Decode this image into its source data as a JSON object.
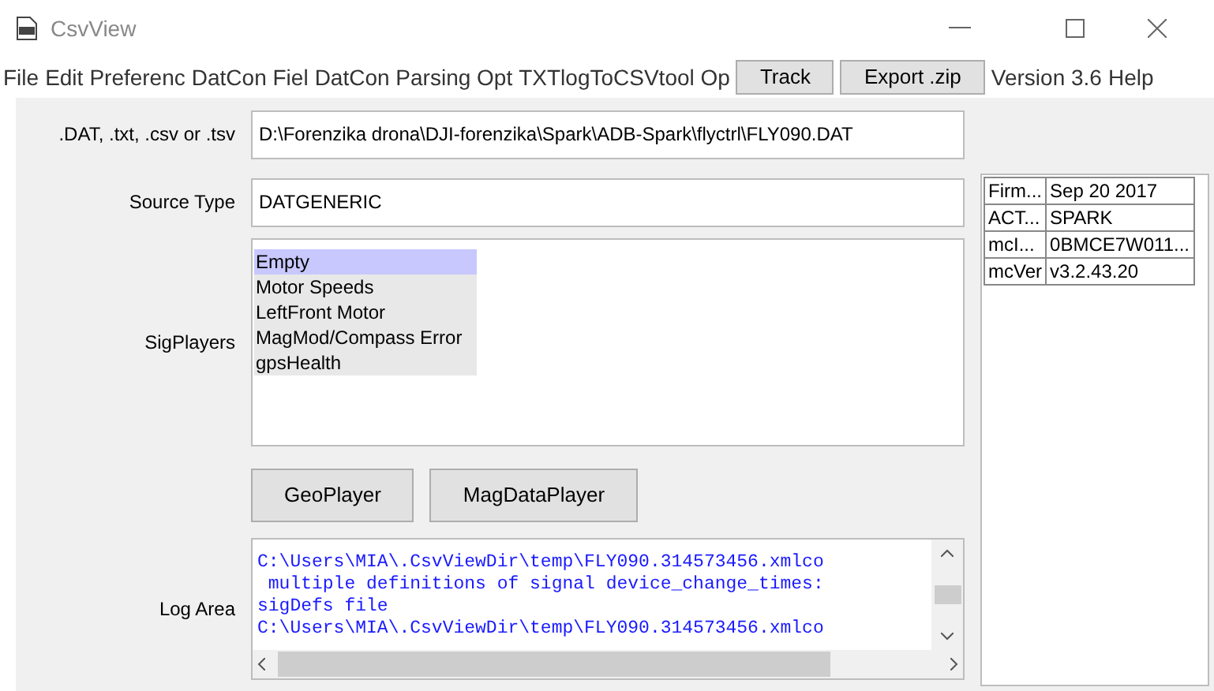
{
  "window": {
    "title": "CsvView"
  },
  "menu": [
    {
      "kind": "menu",
      "label": "File"
    },
    {
      "kind": "menu",
      "label": "Edit"
    },
    {
      "kind": "menu",
      "label": "Preferenc"
    },
    {
      "kind": "menu",
      "label": "DatCon Fiel"
    },
    {
      "kind": "menu",
      "label": "DatCon Parsing Opt"
    },
    {
      "kind": "menu",
      "label": "TXTlogToCSVtool Op"
    },
    {
      "kind": "button",
      "label": "Track"
    },
    {
      "kind": "button",
      "label": "Export .zip"
    },
    {
      "kind": "menu",
      "label": "Version 3.6"
    },
    {
      "kind": "menu",
      "label": "Help"
    }
  ],
  "file": {
    "label": ".DAT, .txt, .csv or .tsv",
    "value": "D:\\Forenzika drona\\DJI-forenzika\\Spark\\ADB-Spark\\flyctrl\\FLY090.DAT"
  },
  "source": {
    "label": "Source Type",
    "value": "DATGENERIC"
  },
  "sigplayers": {
    "label": "SigPlayers",
    "items": [
      {
        "label": "Empty",
        "selected": true
      },
      {
        "label": "Motor Speeds",
        "selected": false
      },
      {
        "label": "LeftFront Motor",
        "selected": false
      },
      {
        "label": "MagMod/Compass Error",
        "selected": false
      },
      {
        "label": "gpsHealth",
        "selected": false
      }
    ]
  },
  "buttons": [
    "GeoPlayer",
    "MagDataPlayer"
  ],
  "log": {
    "label": "Log Area",
    "lines": [
      "C:\\Users\\MIA\\.CsvViewDir\\temp\\FLY090.314573456.xmlco",
      " multiple definitions of signal device_change_times:",
      "sigDefs file",
      "C:\\Users\\MIA\\.CsvViewDir\\temp\\FLY090.314573456.xmlco"
    ]
  },
  "info_table": {
    "rows": [
      [
        "Firm...",
        "Sep 20 2017"
      ],
      [
        "ACT...",
        "SPARK"
      ],
      [
        "mcI...",
        "0BMCE7W011..."
      ],
      [
        "mcVer",
        "v3.2.43.20"
      ]
    ]
  }
}
